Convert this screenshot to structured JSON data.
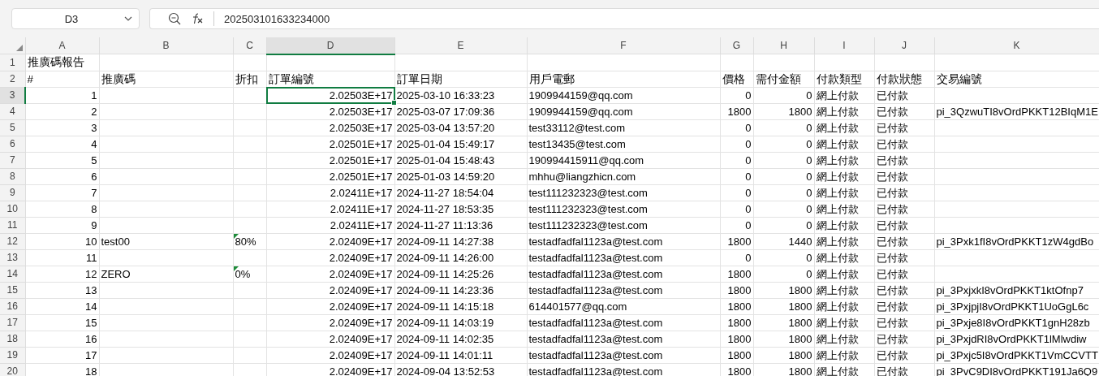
{
  "name_box": {
    "value": "D3"
  },
  "formula_bar": {
    "value": "202503101633234000"
  },
  "columns": [
    {
      "label": "A",
      "kind": "number",
      "selected": false
    },
    {
      "label": "B",
      "kind": "text",
      "selected": false
    },
    {
      "label": "C",
      "kind": "text",
      "selected": false
    },
    {
      "label": "D",
      "kind": "number",
      "selected": true
    },
    {
      "label": "E",
      "kind": "text",
      "selected": false
    },
    {
      "label": "F",
      "kind": "text",
      "selected": false
    },
    {
      "label": "G",
      "kind": "number",
      "selected": false
    },
    {
      "label": "H",
      "kind": "number",
      "selected": false
    },
    {
      "label": "I",
      "kind": "text",
      "selected": false
    },
    {
      "label": "J",
      "kind": "text",
      "selected": false
    },
    {
      "label": "K",
      "kind": "text",
      "selected": false
    }
  ],
  "rows": [
    {
      "number": "1",
      "kind": "title",
      "selected": false,
      "marker": false,
      "cells": [
        "推廣碼報告",
        "",
        "",
        "",
        "",
        "",
        "",
        "",
        "",
        "",
        ""
      ]
    },
    {
      "number": "2",
      "kind": "header",
      "selected": false,
      "marker": false,
      "cells": [
        "#",
        "推廣碼",
        "折扣",
        "訂單編號",
        "訂單日期",
        "用戶電郵",
        "價格",
        "需付金額",
        "付款類型",
        "付款狀態",
        "交易編號"
      ]
    },
    {
      "number": "3",
      "kind": "data",
      "selected": true,
      "marker": false,
      "cells": [
        "1",
        "",
        "",
        "2.02503E+17",
        "2025-03-10 16:33:23",
        "1909944159@qq.com",
        "0",
        "0",
        "網上付款",
        "已付款",
        ""
      ]
    },
    {
      "number": "4",
      "kind": "data",
      "selected": false,
      "marker": false,
      "cells": [
        "2",
        "",
        "",
        "2.02503E+17",
        "2025-03-07 17:09:36",
        "1909944159@qq.com",
        "1800",
        "1800",
        "網上付款",
        "已付款",
        "pi_3QzwuTI8vOrdPKKT12BIqM1E"
      ]
    },
    {
      "number": "5",
      "kind": "data",
      "selected": false,
      "marker": false,
      "cells": [
        "3",
        "",
        "",
        "2.02503E+17",
        "2025-03-04 13:57:20",
        "test33112@test.com",
        "0",
        "0",
        "網上付款",
        "已付款",
        ""
      ]
    },
    {
      "number": "6",
      "kind": "data",
      "selected": false,
      "marker": false,
      "cells": [
        "4",
        "",
        "",
        "2.02501E+17",
        "2025-01-04 15:49:17",
        "test13435@test.com",
        "0",
        "0",
        "網上付款",
        "已付款",
        ""
      ]
    },
    {
      "number": "7",
      "kind": "data",
      "selected": false,
      "marker": false,
      "cells": [
        "5",
        "",
        "",
        "2.02501E+17",
        "2025-01-04 15:48:43",
        "190994415911@qq.com",
        "0",
        "0",
        "網上付款",
        "已付款",
        ""
      ]
    },
    {
      "number": "8",
      "kind": "data",
      "selected": false,
      "marker": false,
      "cells": [
        "6",
        "",
        "",
        "2.02501E+17",
        "2025-01-03 14:59:20",
        "mhhu@liangzhicn.com",
        "0",
        "0",
        "網上付款",
        "已付款",
        ""
      ]
    },
    {
      "number": "9",
      "kind": "data",
      "selected": false,
      "marker": false,
      "cells": [
        "7",
        "",
        "",
        "2.02411E+17",
        "2024-11-27 18:54:04",
        "test111232323@test.com",
        "0",
        "0",
        "網上付款",
        "已付款",
        ""
      ]
    },
    {
      "number": "10",
      "kind": "data",
      "selected": false,
      "marker": false,
      "cells": [
        "8",
        "",
        "",
        "2.02411E+17",
        "2024-11-27 18:53:35",
        "test111232323@test.com",
        "0",
        "0",
        "網上付款",
        "已付款",
        ""
      ]
    },
    {
      "number": "11",
      "kind": "data",
      "selected": false,
      "marker": false,
      "cells": [
        "9",
        "",
        "",
        "2.02411E+17",
        "2024-11-27 11:13:36",
        "test111232323@test.com",
        "0",
        "0",
        "網上付款",
        "已付款",
        ""
      ]
    },
    {
      "number": "12",
      "kind": "data",
      "selected": false,
      "marker": true,
      "cells": [
        "10",
        "test00",
        "80%",
        "2.02409E+17",
        "2024-09-11 14:27:38",
        "testadfadfal1123a@test.com",
        "1800",
        "1440",
        "網上付款",
        "已付款",
        "pi_3Pxk1fI8vOrdPKKT1zW4gdBo"
      ]
    },
    {
      "number": "13",
      "kind": "data",
      "selected": false,
      "marker": false,
      "cells": [
        "11",
        "",
        "",
        "2.02409E+17",
        "2024-09-11 14:26:00",
        "testadfadfal1123a@test.com",
        "0",
        "0",
        "網上付款",
        "已付款",
        ""
      ]
    },
    {
      "number": "14",
      "kind": "data",
      "selected": false,
      "marker": true,
      "cells": [
        "12",
        "ZERO",
        "0%",
        "2.02409E+17",
        "2024-09-11 14:25:26",
        "testadfadfal1123a@test.com",
        "1800",
        "0",
        "網上付款",
        "已付款",
        ""
      ]
    },
    {
      "number": "15",
      "kind": "data",
      "selected": false,
      "marker": false,
      "cells": [
        "13",
        "",
        "",
        "2.02409E+17",
        "2024-09-11 14:23:36",
        "testadfadfal1123a@test.com",
        "1800",
        "1800",
        "網上付款",
        "已付款",
        "pi_3PxjxkI8vOrdPKKT1ktOfnp7"
      ]
    },
    {
      "number": "16",
      "kind": "data",
      "selected": false,
      "marker": false,
      "cells": [
        "14",
        "",
        "",
        "2.02409E+17",
        "2024-09-11 14:15:18",
        "614401577@qq.com",
        "1800",
        "1800",
        "網上付款",
        "已付款",
        "pi_3PxjpjI8vOrdPKKT1UoGgL6c"
      ]
    },
    {
      "number": "17",
      "kind": "data",
      "selected": false,
      "marker": false,
      "cells": [
        "15",
        "",
        "",
        "2.02409E+17",
        "2024-09-11 14:03:19",
        "testadfadfal1123a@test.com",
        "1800",
        "1800",
        "網上付款",
        "已付款",
        "pi_3Pxje8I8vOrdPKKT1gnH28zb"
      ]
    },
    {
      "number": "18",
      "kind": "data",
      "selected": false,
      "marker": false,
      "cells": [
        "16",
        "",
        "",
        "2.02409E+17",
        "2024-09-11 14:02:35",
        "testadfadfal1123a@test.com",
        "1800",
        "1800",
        "網上付款",
        "已付款",
        "pi_3PxjdRI8vOrdPKKT1lMlwdiw"
      ]
    },
    {
      "number": "19",
      "kind": "data",
      "selected": false,
      "marker": false,
      "cells": [
        "17",
        "",
        "",
        "2.02409E+17",
        "2024-09-11 14:01:11",
        "testadfadfal1123a@test.com",
        "1800",
        "1800",
        "網上付款",
        "已付款",
        "pi_3Pxjc5I8vOrdPKKT1VmCCVTT"
      ]
    },
    {
      "number": "20",
      "kind": "data",
      "selected": false,
      "marker": false,
      "cells": [
        "18",
        "",
        "",
        "2.02409E+17",
        "2024-09-04 13:52:53",
        "testadfadfal1123a@test.com",
        "1800",
        "1800",
        "網上付款",
        "已付款",
        "pi_3PvC9DI8vOrdPKKT191Ja6Q9"
      ]
    }
  ]
}
